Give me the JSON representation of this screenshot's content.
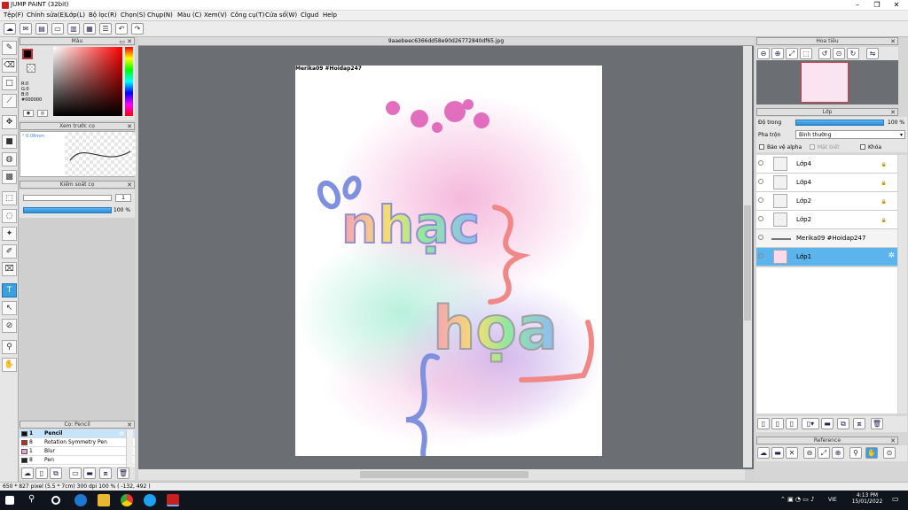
{
  "window": {
    "title": "JUMP PAINT (32bit)"
  },
  "menu": [
    "Tệp(F)",
    "Chỉnh sửa(E)",
    "Lớp(L)",
    "Bộ lọc(R)",
    "Chọn(S)",
    "Chụp(N)",
    "Màu (C)",
    "Xem(V)",
    "Công cụ(T)",
    "Cửa sổ(W)",
    "Clgud",
    "Help"
  ],
  "panels": {
    "color": "Màu",
    "brush_preview": "Xem trước cọ",
    "brush_control": "Kiểm soát cọ",
    "brush_list": "Cọ: Pencil",
    "navigator": "Hoa tiêu",
    "layer": "Lớp",
    "reference": "Reference"
  },
  "color_info": {
    "r": "R:0",
    "g": "G:0",
    "b": "B:0",
    "hex": "#000000"
  },
  "brush_preview": {
    "size": "0.08mm"
  },
  "brush_control": {
    "size_value": "1",
    "opacity": "100 %"
  },
  "brushes": [
    {
      "num": "1",
      "name": "Pencil",
      "color": "#111111"
    },
    {
      "num": "8",
      "name": "Rotation Symmetry Pen",
      "color": "#cc2222"
    },
    {
      "num": "1",
      "name": "Blur",
      "color": "#f0a0d0"
    },
    {
      "num": "8",
      "name": "Pen",
      "color": "#222222"
    }
  ],
  "document": {
    "tab": "9aaebeec6366dd58e90d26772840df65.jpg",
    "watermark": "Merika09 #Hoidap247",
    "art_text_1": "nhạc",
    "art_text_2": "họa"
  },
  "layer_panel": {
    "opacity_label": "Độ trong",
    "opacity_value": "100 %",
    "blend_label": "Pha trộn",
    "blend_value": "Bình thường",
    "protect_alpha": "Bảo vệ alpha",
    "mask": "Mặt biết",
    "lock": "Khóa",
    "layers": [
      {
        "name": "Lớp4",
        "selected": false
      },
      {
        "name": "Lớp4",
        "selected": false
      },
      {
        "name": "Lớp2",
        "selected": false
      },
      {
        "name": "Lớp2",
        "selected": false
      },
      {
        "name": "Merika09 #Hoidap247",
        "selected": false
      },
      {
        "name": "Lớp1",
        "selected": true
      }
    ]
  },
  "status": {
    "text": "650 * 827 pixel  (5.5 * 7cm)  300 dpi  100 %  ( -132, 492 )"
  },
  "taskbar": {
    "lang": "VIE",
    "time": "4:13 PM",
    "date": "15/01/2022"
  }
}
